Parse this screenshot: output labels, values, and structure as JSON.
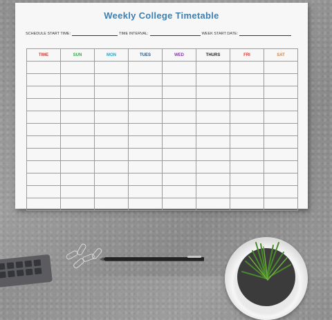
{
  "timetable": {
    "title": "Weekly College Timetable",
    "fields": {
      "schedule_start_label": "SCHEDULE START TIME:",
      "time_interval_label": "TIME INTERVAL:",
      "week_start_label": "WEEK START DATE:"
    },
    "columns": [
      {
        "label": "TIME",
        "color": "#d8362f"
      },
      {
        "label": "SUN",
        "color": "#3aa14a"
      },
      {
        "label": "MON",
        "color": "#2a9fc3"
      },
      {
        "label": "TUES",
        "color": "#1f4f7a"
      },
      {
        "label": "WED",
        "color": "#7b3aa2"
      },
      {
        "label": "THURS",
        "color": "#222222"
      },
      {
        "label": "FRI",
        "color": "#d8362f"
      },
      {
        "label": "SAT",
        "color": "#e07b23"
      }
    ]
  },
  "desk": {
    "icons": [
      "keyboard-icon",
      "paper-clip-icon",
      "pen-icon",
      "plant-pot-icon"
    ]
  }
}
